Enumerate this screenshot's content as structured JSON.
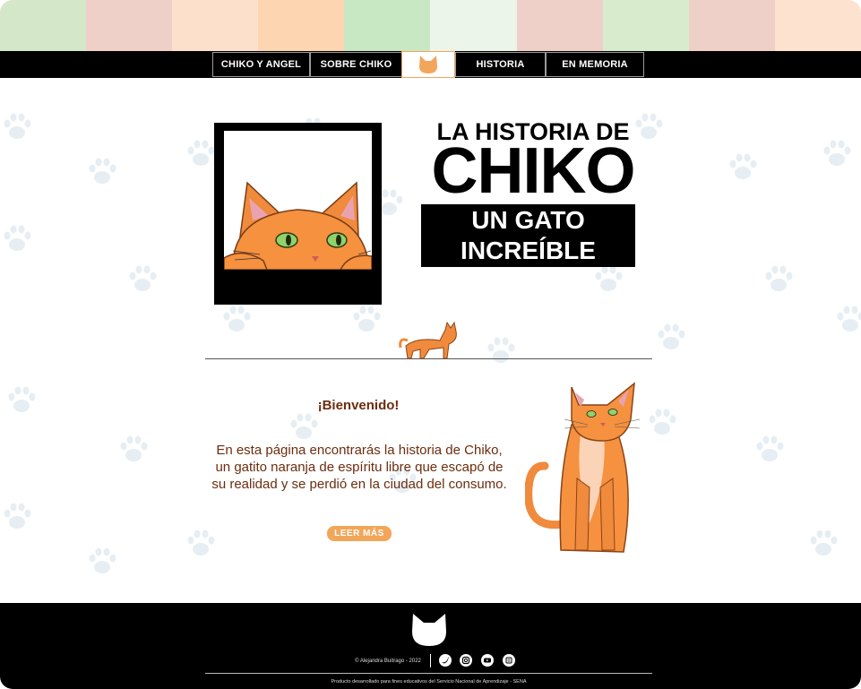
{
  "colors": {
    "stripe": [
      "#d4e8c9",
      "#efd0c9",
      "#fde0cc",
      "#fdd5b1",
      "#c7e8c3",
      "#ecf5e9",
      "#efd0c9",
      "#d9ebcd",
      "#efd0c9",
      "#fde3cf"
    ],
    "accent": "#f2a65a",
    "text_brown": "#6b2d0e",
    "paw": "#e6eef3"
  },
  "nav": {
    "items": [
      {
        "label": "CHIKO Y ANGEL"
      },
      {
        "label": "SOBRE CHIKO"
      },
      {
        "label": "HISTORIA"
      },
      {
        "label": "EN MEMORIA"
      }
    ],
    "logo_icon": "cat-head-icon"
  },
  "hero": {
    "title_small": "LA HISTORIA DE",
    "title_big": "CHIKO",
    "subtitle_line1": "UN GATO",
    "subtitle_line2": "INCREÍBLE"
  },
  "welcome": {
    "title": "¡Bienvenido!",
    "text": "En esta página encontrarás la historia de Chiko, un gatito naranja de espíritu libre que escapó de su realidad y se perdió en la ciudad del consumo.",
    "button": "LEER MÁS"
  },
  "footer": {
    "copyright": "© Alejandra Buitrago - 2022",
    "social": [
      "twitter-icon",
      "instagram-icon",
      "youtube-icon",
      "blog-icon"
    ],
    "credit": "Producto desarrollado para fines educativos del Servicio Nacional de Aprendizaje - SENA"
  }
}
